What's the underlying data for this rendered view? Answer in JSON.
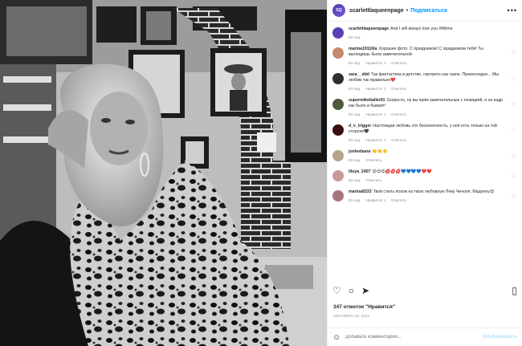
{
  "post": {
    "username": "scarlettlaqueenpage",
    "dot": "•",
    "follow_label": "Подписаться",
    "more_label": "•••",
    "avatar_text": "SQ"
  },
  "comments": [
    {
      "user": "scarlettlaqueenpage",
      "text": "And I will always love you #Mirme",
      "time": "53 нед.",
      "meta": [],
      "avatar_color": "#5b3fb5",
      "has_heart": false
    },
    {
      "user": "marina1911lila",
      "text": "Хорошее фото. С праздником! С праздником тебя! Ты выглядишь была замечательной",
      "time": "53 нед.",
      "meta": [
        "Нравится: 1",
        "Ответить"
      ],
      "avatar_color": "#c58a6b",
      "has_heart": true
    },
    {
      "user": "sara__ddd",
      "text": "Так фантастика в детстве, смотреть как такое. Превосходно... Мы любим так правильно❤️",
      "time": "53 нед.",
      "meta": [
        "Нравится: 1",
        "Ответить"
      ],
      "avatar_color": "#2f2f2f",
      "has_heart": true
    },
    {
      "user": "supermikeballer01",
      "text": "Скорость, ну вы прям замечательные с позицией, я на кадр как было и бывает!",
      "time": "53 нед.",
      "meta": [
        "Нравится: 1",
        "Ответить"
      ],
      "avatar_color": "#4d5a3c",
      "has_heart": true
    },
    {
      "user": "d_v_trigger",
      "text": "Настоящая любовь это бесконечность, у неё есть только на той стороне🖤",
      "time": "53 нед.",
      "meta": [
        "Нравится: 1",
        "Ответить"
      ],
      "avatar_color": "#3a0e0e",
      "has_heart": true
    },
    {
      "user": "jonleebana",
      "text": "👏👏👏",
      "time": "53 нед.",
      "meta": [
        "Ответить"
      ],
      "avatar_color": "#b5a58a",
      "has_heart": true
    },
    {
      "user": "lileya_2407",
      "text": "😍😍😍💋💋💋💙💙💙💙❤️❤️",
      "time": "53 нед.",
      "meta": [
        "Ответить"
      ],
      "avatar_color": "#c79a9a",
      "has_heart": true
    },
    {
      "user": "marina8333",
      "text": "Твой стиль похож на твою любовную Леку Чичоля, Мадонну😍",
      "time": "53 нед.",
      "meta": [
        "Нравится: 1",
        "Ответить"
      ],
      "avatar_color": "#a8757e",
      "has_heart": true
    }
  ],
  "actions": {
    "like_icon": "♡",
    "comment_icon": "○",
    "share_icon": "➤",
    "save_icon": "▯"
  },
  "likes_text": "347 отметок \"Нравится\"",
  "date_text": "СЕНТЯБРЬ 10, 2021",
  "add_comment": {
    "emoji_icon": "☺",
    "placeholder": "Добавьте комментарий...",
    "post_label": "Опубликовать"
  }
}
